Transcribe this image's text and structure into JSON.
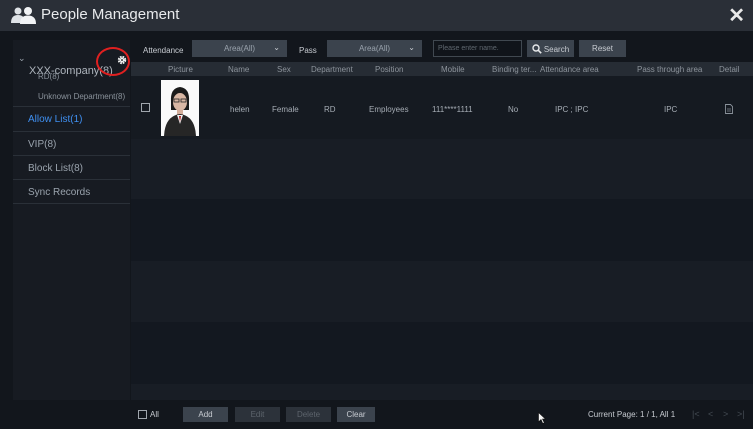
{
  "window": {
    "title": "People Management",
    "close_glyph": "✕"
  },
  "sidebar": {
    "company": {
      "label": "XXX-company(8)",
      "chevron": "⌄"
    },
    "departments": [
      "RD(8)",
      "Unknown Department(8)"
    ],
    "items": [
      {
        "label": "Allow List(1)",
        "active": true
      },
      {
        "label": "VIP(8)",
        "active": false
      },
      {
        "label": "Block List(8)",
        "active": false
      },
      {
        "label": "Sync Records",
        "active": false
      }
    ]
  },
  "toolbar": {
    "attendance_label": "Attendance",
    "attendance_value": "Area(All)",
    "pass_label": "Pass",
    "pass_value": "Area(All)",
    "search_placeholder": "Please enter name.",
    "search_label": "Search",
    "reset_label": "Reset"
  },
  "table": {
    "columns": [
      "Picture",
      "Name",
      "Sex",
      "Department",
      "Position",
      "Mobile",
      "Binding ter...",
      "Attendance area",
      "Pass through area",
      "Detail"
    ],
    "rows": [
      {
        "name": "helen",
        "sex": "Female",
        "department": "RD",
        "position": "Employees",
        "mobile": "111****1111",
        "binding": "No",
        "attendance_area": "IPC ; IPC",
        "pass_area": "IPC"
      }
    ]
  },
  "bottom": {
    "all_label": "All",
    "add_label": "Add",
    "edit_label": "Edit",
    "delete_label": "Delete",
    "clear_label": "Clear",
    "page_info": "Current Page: 1 / 1, All 1",
    "pager": [
      "|<",
      "<",
      ">",
      ">|"
    ]
  },
  "icons": {
    "logo": "people-icon",
    "gear": "gear-icon",
    "search": "search-icon",
    "detail": "document-icon",
    "close": "close-icon"
  },
  "colors": {
    "accent": "#3f8ff0",
    "highlight_circle": "#e02020",
    "titlebar": "#2a2f37"
  }
}
